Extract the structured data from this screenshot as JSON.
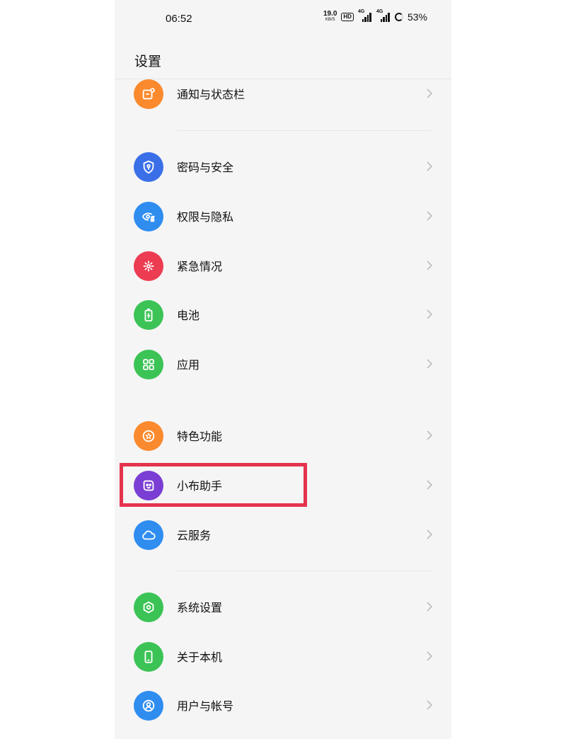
{
  "status_bar": {
    "time": "06:52",
    "net_speed_value": "19.0",
    "net_speed_unit": "KB/S",
    "hd_badge": "HD",
    "signal1_label": "4G",
    "signal2_label": "4G",
    "battery_percent": "53%"
  },
  "header": {
    "title": "设置"
  },
  "items": [
    {
      "label": "通知与状态栏",
      "icon": "notification-icon",
      "color": "#fa8a2d"
    },
    {
      "label": "密码与安全",
      "icon": "shield-key-icon",
      "color": "#3a6fe8"
    },
    {
      "label": "权限与隐私",
      "icon": "eye-lock-icon",
      "color": "#2f8df0"
    },
    {
      "label": "紧急情况",
      "icon": "emergency-icon",
      "color": "#ec3c51"
    },
    {
      "label": "电池",
      "icon": "battery-icon",
      "color": "#3cc356"
    },
    {
      "label": "应用",
      "icon": "apps-grid-icon",
      "color": "#3cc356"
    },
    {
      "label": "特色功能",
      "icon": "star-badge-icon",
      "color": "#fa8a2d"
    },
    {
      "label": "小布助手",
      "icon": "assistant-icon",
      "color": "#7b3ed4"
    },
    {
      "label": "云服务",
      "icon": "cloud-icon",
      "color": "#2f8df0"
    },
    {
      "label": "系统设置",
      "icon": "hexagon-gear-icon",
      "color": "#3cc356"
    },
    {
      "label": "关于本机",
      "icon": "phone-icon",
      "color": "#3cc356"
    },
    {
      "label": "用户与帐号",
      "icon": "user-icon",
      "color": "#2f8df0"
    }
  ]
}
